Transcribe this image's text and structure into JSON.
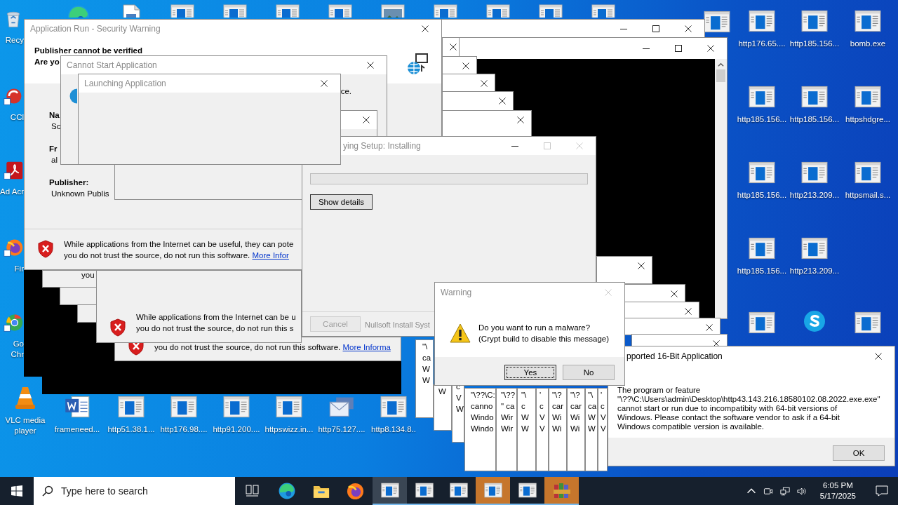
{
  "desktop_icons": [
    {
      "kind": "recycle-bin",
      "label": "Recy"
    },
    {
      "kind": "ccleaner",
      "label": "CCl"
    },
    {
      "kind": "acrobat",
      "label": "Ad Acr"
    },
    {
      "kind": "firefox",
      "label": "Fir"
    },
    {
      "kind": "chrome",
      "label": "Go Chr"
    },
    {
      "kind": "vlc",
      "label": "VLC media player"
    },
    {
      "kind": "word",
      "label": "frameneed..."
    },
    {
      "kind": "window-file",
      "label": "http51.38.1..."
    },
    {
      "kind": "window-file",
      "label": "http176.98...."
    },
    {
      "kind": "window-file",
      "label": "http91.200...."
    },
    {
      "kind": "window-file",
      "label": "httpswizz.in..."
    },
    {
      "kind": "mail",
      "label": "http75.127...."
    },
    {
      "kind": "window-file",
      "label": "http8.134.8.."
    },
    {
      "kind": "window-file",
      "label": "http176.65...."
    },
    {
      "kind": "window-file",
      "label": "http185.156..."
    },
    {
      "kind": "window-file",
      "label": "bomb.exe"
    },
    {
      "kind": "window-file",
      "label": "http185.156..."
    },
    {
      "kind": "window-file",
      "label": "http185.156..."
    },
    {
      "kind": "window-file",
      "label": "httpshdgre..."
    },
    {
      "kind": "window-file",
      "label": "http185.156..."
    },
    {
      "kind": "window-file",
      "label": "http213.209..."
    },
    {
      "kind": "window-file",
      "label": "httpsmail.s..."
    },
    {
      "kind": "window-file",
      "label": "http185.156..."
    },
    {
      "kind": "window-file",
      "label": "http213.209..."
    },
    {
      "kind": "window-file"
    },
    {
      "kind": "skype"
    },
    {
      "kind": "window-file"
    },
    {
      "kind": "edge"
    },
    {
      "kind": "doc"
    },
    {
      "kind": "window-file"
    },
    {
      "kind": "window-file"
    },
    {
      "kind": "window-file"
    },
    {
      "kind": "window-file"
    },
    {
      "kind": "picture-window"
    },
    {
      "kind": "window-file"
    },
    {
      "kind": "window-file"
    },
    {
      "kind": "window-file"
    },
    {
      "kind": "window-file"
    },
    {
      "kind": "window-file"
    }
  ],
  "windows": [
    {
      "kind": "titlebar"
    },
    {
      "kind": "console"
    },
    {
      "kind": "closebox"
    },
    {
      "kind": "closebox"
    },
    {
      "kind": "closebox"
    },
    {
      "kind": "closebox"
    },
    {
      "kind": "closebox"
    },
    {
      "kind": "closebox"
    },
    {
      "kind": "closebox"
    },
    {
      "kind": "closebox"
    },
    {
      "kind": "closebox"
    },
    {
      "kind": "closebox"
    },
    {
      "kind": "blackout"
    },
    {
      "kind": "blackout"
    },
    {
      "kind": "security-warning",
      "title": "Application Run - Security Warning",
      "active": false,
      "header_lines": [
        "Publisher cannot be verified",
        "Are yo"
      ],
      "fields": [
        {
          "label": "Na",
          "value": "Sc"
        },
        {
          "label": "Fr",
          "value": "al"
        },
        {
          "label": "Publisher:",
          "value": "Unknown Publis"
        }
      ],
      "message_lines": [
        "While applications from the Internet can be useful, they can pote",
        "you do not trust the source, do not run this software."
      ],
      "link": "More Infor"
    },
    {
      "kind": "dialog",
      "title": "Cannot Start Application",
      "active": false,
      "text": "ce."
    },
    {
      "kind": "dialog"
    },
    {
      "kind": "setup",
      "title": "ying Setup: Installing",
      "active": false,
      "close_disabled": true,
      "level": 0,
      "buttons": [
        {
          "label": "Show details",
          "disabled": false
        },
        {
          "label": "Cancel",
          "disabled": true
        }
      ],
      "brand": "Nullsoft Install Syst"
    },
    {
      "kind": "dialog",
      "title": "Launching Application",
      "active": false
    },
    {
      "kind": "security-warning",
      "message_lines": [
        "you do not trust the source, do not run this software."
      ],
      "link": "More Informa"
    },
    {
      "kind": "fragment"
    },
    {
      "kind": "fragment"
    },
    {
      "kind": "fragment",
      "lines": [
        "you"
      ]
    },
    {
      "kind": "security-warning",
      "message_lines": [
        "While applications from the Internet can be u",
        "you do not trust the source, do not run this s"
      ]
    },
    {
      "kind": "sliver",
      "lines": [
        "\"\\",
        "ca",
        "W",
        "W"
      ]
    },
    {
      "kind": "sliver",
      "lines": [
        "W"
      ]
    },
    {
      "kind": "sliver",
      "lines": [
        "c",
        "V",
        "W"
      ]
    },
    {
      "kind": "sliver",
      "lines": [
        "\"\\??\\C:",
        "canno",
        "Windo",
        "Windo"
      ]
    },
    {
      "kind": "sliver",
      "lines": [
        "\"\\??",
        "\" ca",
        "Wir",
        "Wir"
      ]
    },
    {
      "kind": "sliver",
      "lines": [
        "\"\\",
        "c",
        "W",
        "W"
      ]
    },
    {
      "kind": "sliver",
      "lines": [
        "'",
        "c",
        "V",
        "V"
      ]
    },
    {
      "kind": "sliver",
      "lines": [
        "\"\\?",
        "car",
        "Wi",
        "Wi"
      ]
    },
    {
      "kind": "sliver",
      "lines": [
        "\"\\?",
        "car",
        "Wi",
        "Wi"
      ]
    },
    {
      "kind": "sliver",
      "lines": [
        "\"\\",
        "ca",
        "W",
        "W"
      ]
    },
    {
      "kind": "sliver",
      "lines": [
        "'",
        "c",
        "V",
        "V"
      ]
    },
    {
      "kind": "message",
      "title": "pported 16-Bit Application",
      "active": true,
      "close_disabled": false,
      "message_lines": [
        "The program or feature",
        "\"\\??\\C:\\Users\\admin\\Desktop\\http43.143.216.18580102.08.2022.exe.exe\"",
        "cannot start or run due to incompatibity with 64-bit versions of",
        "Windows. Please contact the software vendor to ask if a 64-bit",
        "Windows compatible version is available."
      ],
      "buttons": [
        {
          "label": "OK",
          "focused": false
        }
      ]
    },
    {
      "kind": "warning-prompt",
      "title": "Warning",
      "active": false,
      "close_disabled": true,
      "message_lines": [
        "Do you want to run a malware?",
        "(Crypt build to disable this message)"
      ],
      "buttons": [
        {
          "label": "Yes",
          "focused": true
        },
        {
          "label": "No",
          "focused": false
        }
      ]
    }
  ],
  "taskbar": {
    "search": {
      "placeholder": "Type here to search"
    },
    "pinned": [
      {
        "kind": "task-view"
      },
      {
        "kind": "edge"
      },
      {
        "kind": "explorer"
      },
      {
        "kind": "firefox"
      }
    ],
    "apps": [
      {
        "kind": "window-app",
        "selected": true,
        "attention": false
      },
      {
        "kind": "window-app",
        "selected": false,
        "attention": false
      },
      {
        "kind": "window-app",
        "selected": false,
        "attention": false
      },
      {
        "kind": "window-app",
        "selected": false,
        "attention": true
      },
      {
        "kind": "window-app",
        "selected": false,
        "attention": false
      },
      {
        "kind": "archive",
        "selected": false,
        "attention": true
      }
    ],
    "time": "6:05 PM",
    "date": "5/17/2025"
  }
}
